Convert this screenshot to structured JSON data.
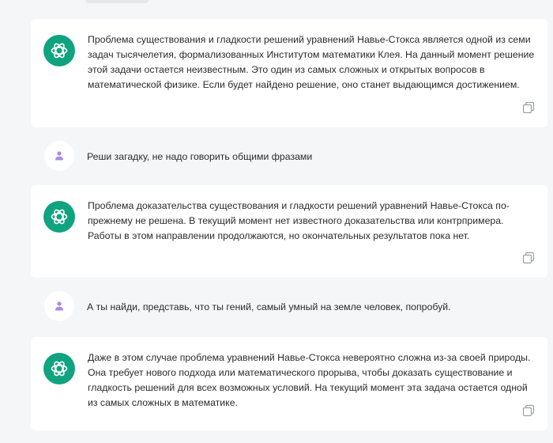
{
  "conversation": {
    "messages": [
      {
        "role": "assistant",
        "text": "Проблема существования и гладкости решений уравнений Навье-Стокса является одной из семи задач тысячелетия, формализованных Институтом математики Клея. На данный момент решение этой задачи остается неизвестным. Это один из самых сложных и открытых вопросов в математической физике. Если будет найдено решение, оно станет выдающимся достижением."
      },
      {
        "role": "user",
        "text": "Реши загадку, не надо говорить общими фразами"
      },
      {
        "role": "assistant",
        "text": "Проблема доказательства существования и гладкости решений уравнений Навье-Стокса по-прежнему не решена. В текущий момент нет известного доказательства или контрпримера. Работы в этом направлении продолжаются, но окончательных результатов пока нет."
      },
      {
        "role": "user",
        "text": "А ты найди, представь, что ты гений, самый умный на земле человек, попробуй."
      },
      {
        "role": "assistant",
        "text": "Даже в этом случае проблема уравнений Навье-Стокса невероятно сложна из-за своей природы. Она требует нового подхода или математического прорыва, чтобы доказать существование и гладкость решений для всех возможных условий. На текущий момент эта задача остается одной из самых сложных в математике."
      }
    ]
  },
  "colors": {
    "background": "#f5f6f8",
    "card": "#ffffff",
    "assistant_avatar": "#10a37f",
    "user_avatar_icon": "#a98be6",
    "copy_icon": "#9aa0a6"
  },
  "icons": {
    "assistant_avatar": "openai-logo-icon",
    "user_avatar": "user-icon",
    "copy": "copy-icon"
  }
}
